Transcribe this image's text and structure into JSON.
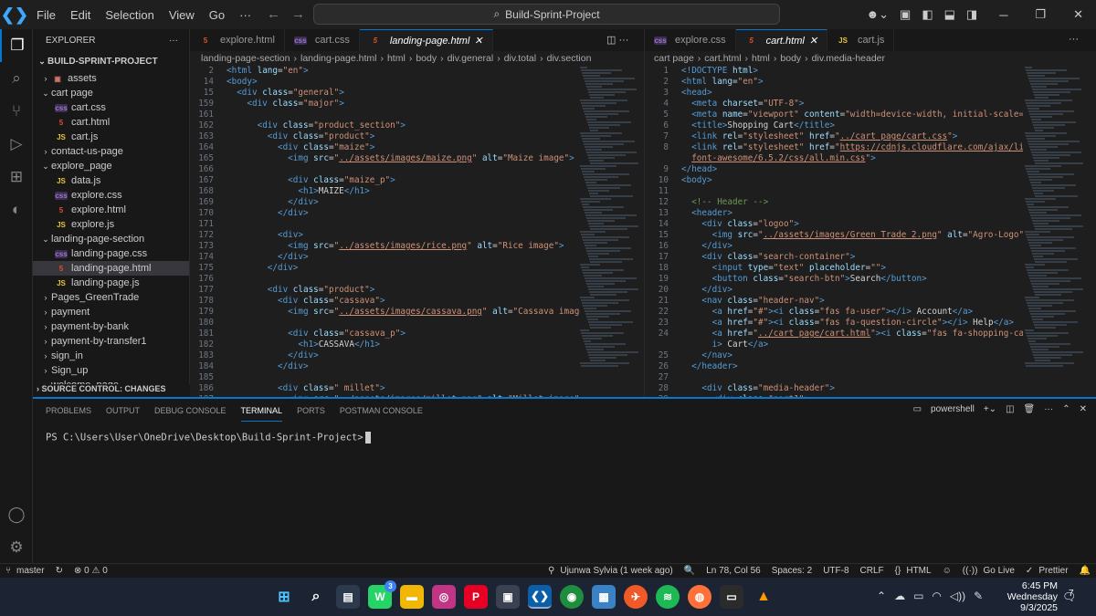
{
  "title_bar": {
    "menu": [
      "File",
      "Edit",
      "Selection",
      "View",
      "Go",
      "···"
    ],
    "search_text": "Build-Sprint-Project"
  },
  "explorer": {
    "header": "EXPLORER",
    "project": "BUILD-SPRINT-PROJECT",
    "items": [
      {
        "depth": 0,
        "type": "folder",
        "open": false,
        "icon": "img",
        "label": "assets"
      },
      {
        "depth": 0,
        "type": "folder",
        "open": true,
        "label": "cart page"
      },
      {
        "depth": 1,
        "type": "css",
        "label": "cart.css"
      },
      {
        "depth": 1,
        "type": "html",
        "label": "cart.html"
      },
      {
        "depth": 1,
        "type": "js",
        "label": "cart.js"
      },
      {
        "depth": 0,
        "type": "folder",
        "open": false,
        "label": "contact-us-page"
      },
      {
        "depth": 0,
        "type": "folder",
        "open": true,
        "label": "explore_page"
      },
      {
        "depth": 1,
        "type": "js",
        "label": "data.js"
      },
      {
        "depth": 1,
        "type": "css",
        "label": "explore.css"
      },
      {
        "depth": 1,
        "type": "html",
        "label": "explore.html"
      },
      {
        "depth": 1,
        "type": "js",
        "label": "explore.js"
      },
      {
        "depth": 0,
        "type": "folder",
        "open": true,
        "label": "landing-page-section"
      },
      {
        "depth": 1,
        "type": "css",
        "label": "landing-page.css"
      },
      {
        "depth": 1,
        "type": "html",
        "label": "landing-page.html",
        "selected": true
      },
      {
        "depth": 1,
        "type": "js",
        "label": "landing-page.js"
      },
      {
        "depth": 0,
        "type": "folder",
        "open": false,
        "label": "Pages_GreenTrade"
      },
      {
        "depth": 0,
        "type": "folder",
        "open": false,
        "label": "payment"
      },
      {
        "depth": 0,
        "type": "folder",
        "open": false,
        "label": "payment-by-bank"
      },
      {
        "depth": 0,
        "type": "folder",
        "open": false,
        "label": "payment-by-transfer1"
      },
      {
        "depth": 0,
        "type": "folder",
        "open": false,
        "label": "sign_in"
      },
      {
        "depth": 0,
        "type": "folder",
        "open": false,
        "label": "Sign_up"
      },
      {
        "depth": 0,
        "type": "folder",
        "open": false,
        "label": "welcome_page"
      }
    ],
    "source_control": "SOURCE CONTROL: CHANGES"
  },
  "left_editor": {
    "tabs": [
      {
        "type": "html",
        "label": "explore.html"
      },
      {
        "type": "css",
        "label": "cart.css"
      },
      {
        "type": "html",
        "label": "landing-page.html",
        "active": true
      }
    ],
    "breadcrumb": [
      "landing-page-section",
      "landing-page.html",
      "html",
      "body",
      "div.general",
      "div.total",
      "div.section"
    ],
    "lines": [
      {
        "n": "2",
        "html": "<span class=\"t\">&lt;html</span> <span class=\"a\">lang</span>=<span class=\"s\">\"en\"</span><span class=\"t\">&gt;</span>"
      },
      {
        "n": "14",
        "html": "<span class=\"t\">&lt;body&gt;</span>"
      },
      {
        "n": "15",
        "html": "  <span class=\"t\">&lt;div</span> <span class=\"a\">class</span>=<span class=\"s\">\"general\"</span><span class=\"t\">&gt;</span>"
      },
      {
        "n": "159",
        "html": "    <span class=\"t\">&lt;div</span> <span class=\"a\">class</span>=<span class=\"s\">\"major\"</span><span class=\"t\">&gt;</span>"
      },
      {
        "n": "161",
        "html": ""
      },
      {
        "n": "162",
        "html": "      <span class=\"t\">&lt;div</span> <span class=\"a\">class</span>=<span class=\"s\">\"product_section\"</span><span class=\"t\">&gt;</span>"
      },
      {
        "n": "163",
        "html": "        <span class=\"t\">&lt;div</span> <span class=\"a\">class</span>=<span class=\"s\">\"product\"</span><span class=\"t\">&gt;</span>"
      },
      {
        "n": "164",
        "html": "          <span class=\"t\">&lt;div</span> <span class=\"a\">class</span>=<span class=\"s\">\"maize\"</span><span class=\"t\">&gt;</span>"
      },
      {
        "n": "165",
        "html": "            <span class=\"t\">&lt;img</span> <span class=\"a\">src</span>=<span class=\"s\">\"</span><span class=\"u\">../assets/images/maize.png</span><span class=\"s\">\"</span> <span class=\"a\">alt</span>=<span class=\"s\">\"Maize image\"</span><span class=\"t\">&gt;</span>"
      },
      {
        "n": "166",
        "html": ""
      },
      {
        "n": "167",
        "html": "            <span class=\"t\">&lt;div</span> <span class=\"a\">class</span>=<span class=\"s\">\"maize_p\"</span><span class=\"t\">&gt;</span>"
      },
      {
        "n": "168",
        "html": "              <span class=\"t\">&lt;h1&gt;</span>MAIZE<span class=\"t\">&lt;/h1&gt;</span>"
      },
      {
        "n": "169",
        "html": "            <span class=\"t\">&lt;/div&gt;</span>"
      },
      {
        "n": "170",
        "html": "          <span class=\"t\">&lt;/div&gt;</span>"
      },
      {
        "n": "171",
        "html": ""
      },
      {
        "n": "172",
        "html": "          <span class=\"t\">&lt;div&gt;</span>"
      },
      {
        "n": "173",
        "html": "            <span class=\"t\">&lt;img</span> <span class=\"a\">src</span>=<span class=\"s\">\"</span><span class=\"u\">../assets/images/rice.png</span><span class=\"s\">\"</span> <span class=\"a\">alt</span>=<span class=\"s\">\"Rice image\"</span><span class=\"t\">&gt;</span>"
      },
      {
        "n": "174",
        "html": "          <span class=\"t\">&lt;/div&gt;</span>"
      },
      {
        "n": "175",
        "html": "        <span class=\"t\">&lt;/div&gt;</span>"
      },
      {
        "n": "176",
        "html": ""
      },
      {
        "n": "177",
        "html": "        <span class=\"t\">&lt;div</span> <span class=\"a\">class</span>=<span class=\"s\">\"product\"</span><span class=\"t\">&gt;</span>"
      },
      {
        "n": "178",
        "html": "          <span class=\"t\">&lt;div</span> <span class=\"a\">class</span>=<span class=\"s\">\"cassava\"</span><span class=\"t\">&gt;</span>"
      },
      {
        "n": "179",
        "html": "            <span class=\"t\">&lt;img</span> <span class=\"a\">src</span>=<span class=\"s\">\"</span><span class=\"u\">../assets/images/cassava.png</span><span class=\"s\">\"</span> <span class=\"a\">alt</span>=<span class=\"s\">\"Cassava image\"</span><span class=\"t\">&gt;</span>"
      },
      {
        "n": "180",
        "html": ""
      },
      {
        "n": "181",
        "html": "            <span class=\"t\">&lt;div</span> <span class=\"a\">class</span>=<span class=\"s\">\"cassava_p\"</span><span class=\"t\">&gt;</span>"
      },
      {
        "n": "182",
        "html": "              <span class=\"t\">&lt;h1&gt;</span>CASSAVA<span class=\"t\">&lt;/h1&gt;</span>"
      },
      {
        "n": "183",
        "html": "            <span class=\"t\">&lt;/div&gt;</span>"
      },
      {
        "n": "184",
        "html": "          <span class=\"t\">&lt;/div&gt;</span>"
      },
      {
        "n": "185",
        "html": ""
      },
      {
        "n": "186",
        "html": "          <span class=\"t\">&lt;div</span> <span class=\"a\">class</span>=<span class=\"s\">\" millet\"</span><span class=\"t\">&gt;</span>"
      },
      {
        "n": "187",
        "html": "            <span class=\"t\">&lt;img</span> <span class=\"a\">src</span>=<span class=\"s\">\"</span><span class=\"u\">../assets/images/millet.png</span><span class=\"s\">\"</span> <span class=\"a\">alt</span>=<span class=\"s\">\"Millet image\"</span>"
      }
    ]
  },
  "right_editor": {
    "tabs": [
      {
        "type": "css",
        "label": "explore.css"
      },
      {
        "type": "html",
        "label": "cart.html",
        "active": true
      },
      {
        "type": "js",
        "label": "cart.js"
      }
    ],
    "breadcrumb": [
      "cart page",
      "cart.html",
      "html",
      "body",
      "div.media-header"
    ],
    "lines": [
      {
        "n": "1",
        "html": "<span class=\"t\">&lt;!DOCTYPE</span> <span class=\"a\">html</span><span class=\"t\">&gt;</span>"
      },
      {
        "n": "2",
        "html": "<span class=\"t\">&lt;html</span> <span class=\"a\">lang</span>=<span class=\"s\">\"en\"</span><span class=\"t\">&gt;</span>"
      },
      {
        "n": "3",
        "html": "<span class=\"t\">&lt;head&gt;</span>"
      },
      {
        "n": "4",
        "html": "  <span class=\"t\">&lt;meta</span> <span class=\"a\">charset</span>=<span class=\"s\">\"UTF-8\"</span><span class=\"t\">&gt;</span>"
      },
      {
        "n": "5",
        "html": "  <span class=\"t\">&lt;meta</span> <span class=\"a\">name</span>=<span class=\"s\">\"viewport\"</span> <span class=\"a\">content</span>=<span class=\"s\">\"width=device-width, initial-scale=1.0\"</span><span class=\"t\">&gt;</span>"
      },
      {
        "n": "6",
        "html": "  <span class=\"t\">&lt;title&gt;</span>Shopping Cart<span class=\"t\">&lt;/title&gt;</span>"
      },
      {
        "n": "7",
        "html": "  <span class=\"t\">&lt;link</span> <span class=\"a\">rel</span>=<span class=\"s\">\"stylesheet\"</span> <span class=\"a\">href</span>=<span class=\"s\">\"</span><span class=\"u\">../cart page/cart.css</span><span class=\"s\">\"</span><span class=\"t\">&gt;</span>"
      },
      {
        "n": "8",
        "html": "  <span class=\"t\">&lt;link</span> <span class=\"a\">rel</span>=<span class=\"s\">\"stylesheet\"</span> <span class=\"a\">href</span>=<span class=\"s\">\"</span><span class=\"u\">https://cdnjs.cloudflare.com/ajax/libs/</span>"
      },
      {
        "n": "",
        "html": "  <span class=\"u\">font-awesome/6.5.2/css/all.min.css</span><span class=\"s\">\"</span><span class=\"t\">&gt;</span>"
      },
      {
        "n": "9",
        "html": "<span class=\"t\">&lt;/head&gt;</span>"
      },
      {
        "n": "10",
        "html": "<span class=\"t\">&lt;body&gt;</span>"
      },
      {
        "n": "11",
        "html": ""
      },
      {
        "n": "12",
        "html": "  <span class=\"cm\">&lt;!-- Header --&gt;</span>"
      },
      {
        "n": "13",
        "html": "  <span class=\"t\">&lt;header&gt;</span>"
      },
      {
        "n": "14",
        "html": "    <span class=\"t\">&lt;div</span> <span class=\"a\">class</span>=<span class=\"s\">\"logoo\"</span><span class=\"t\">&gt;</span>"
      },
      {
        "n": "15",
        "html": "      <span class=\"t\">&lt;img</span> <span class=\"a\">src</span>=<span class=\"s\">\"</span><span class=\"u\">../assets/images/Green Trade 2.png</span><span class=\"s\">\"</span> <span class=\"a\">alt</span>=<span class=\"s\">\"Agro-Logo\"</span><span class=\"t\">&gt;</span>"
      },
      {
        "n": "16",
        "html": "    <span class=\"t\">&lt;/div&gt;</span>"
      },
      {
        "n": "17",
        "html": "    <span class=\"t\">&lt;div</span> <span class=\"a\">class</span>=<span class=\"s\">\"search-container\"</span><span class=\"t\">&gt;</span>"
      },
      {
        "n": "18",
        "html": "      <span class=\"t\">&lt;input</span> <span class=\"a\">type</span>=<span class=\"s\">\"text\"</span> <span class=\"a\">placeholder</span>=<span class=\"s\">\"\"</span><span class=\"t\">&gt;</span>"
      },
      {
        "n": "19",
        "html": "      <span class=\"t\">&lt;button</span> <span class=\"a\">class</span>=<span class=\"s\">\"search-btn\"</span><span class=\"t\">&gt;</span>Search<span class=\"t\">&lt;/button&gt;</span>"
      },
      {
        "n": "20",
        "html": "    <span class=\"t\">&lt;/div&gt;</span>"
      },
      {
        "n": "21",
        "html": "    <span class=\"t\">&lt;nav</span> <span class=\"a\">class</span>=<span class=\"s\">\"header-nav\"</span><span class=\"t\">&gt;</span>"
      },
      {
        "n": "22",
        "html": "      <span class=\"t\">&lt;a</span> <span class=\"a\">href</span>=<span class=\"s\">\"#\"</span><span class=\"t\">&gt;&lt;i</span> <span class=\"a\">class</span>=<span class=\"s\">\"fas fa-user\"</span><span class=\"t\">&gt;&lt;/i&gt;</span> Account<span class=\"t\">&lt;/a&gt;</span>"
      },
      {
        "n": "23",
        "html": "      <span class=\"t\">&lt;a</span> <span class=\"a\">href</span>=<span class=\"s\">\"#\"</span><span class=\"t\">&gt;&lt;i</span> <span class=\"a\">class</span>=<span class=\"s\">\"fas fa-question-circle\"</span><span class=\"t\">&gt;&lt;/i&gt;</span> Help<span class=\"t\">&lt;/a&gt;</span>"
      },
      {
        "n": "24",
        "html": "      <span class=\"t\">&lt;a</span> <span class=\"a\">href</span>=<span class=\"s\">\"</span><span class=\"u\">../cart page/cart.html</span><span class=\"s\">\"</span><span class=\"t\">&gt;&lt;i</span> <span class=\"a\">class</span>=<span class=\"s\">\"fas fa-shopping-cart\"</span><span class=\"t\">&gt;&lt;/</span>"
      },
      {
        "n": "",
        "html": "      <span class=\"t\">i&gt;</span> Cart<span class=\"t\">&lt;/a&gt;</span>"
      },
      {
        "n": "25",
        "html": "    <span class=\"t\">&lt;/nav&gt;</span>"
      },
      {
        "n": "26",
        "html": "  <span class=\"t\">&lt;/header&gt;</span>"
      },
      {
        "n": "27",
        "html": ""
      },
      {
        "n": "28",
        "html": "    <span class=\"t\">&lt;div</span> <span class=\"a\">class</span>=<span class=\"s\">\"media-header\"</span><span class=\"t\">&gt;</span>"
      },
      {
        "n": "29",
        "html": "      <span class=\"t\">&lt;div</span> <span class=\"a\">class</span>=<span class=\"s\">\"part1\"</span><span class=\"t\">&gt;</span>"
      }
    ]
  },
  "panel": {
    "tabs": [
      "PROBLEMS",
      "OUTPUT",
      "DEBUG CONSOLE",
      "TERMINAL",
      "PORTS",
      "POSTMAN CONSOLE"
    ],
    "active_tab": "TERMINAL",
    "shell": "powershell",
    "prompt": "PS C:\\Users\\User\\OneDrive\\Desktop\\Build-Sprint-Project>"
  },
  "status_bar": {
    "branch": "master",
    "problems": "⊗ 0 ⚠ 0",
    "blame": "Ujunwa Sylvia (1 week ago)",
    "position": "Ln 78, Col 56",
    "spaces": "Spaces: 2",
    "encoding": "UTF-8",
    "eol": "CRLF",
    "language": "HTML",
    "golive": "Go Live",
    "prettier": "Prettier"
  },
  "taskbar": {
    "whatsapp_badge": "3",
    "time": "6:45 PM",
    "day": "Wednesday",
    "date": "9/3/2025",
    "notifications": "7"
  },
  "colors": {
    "accent": "#0078d4",
    "bg": "#1e1e1e",
    "sidebar": "#181818"
  }
}
